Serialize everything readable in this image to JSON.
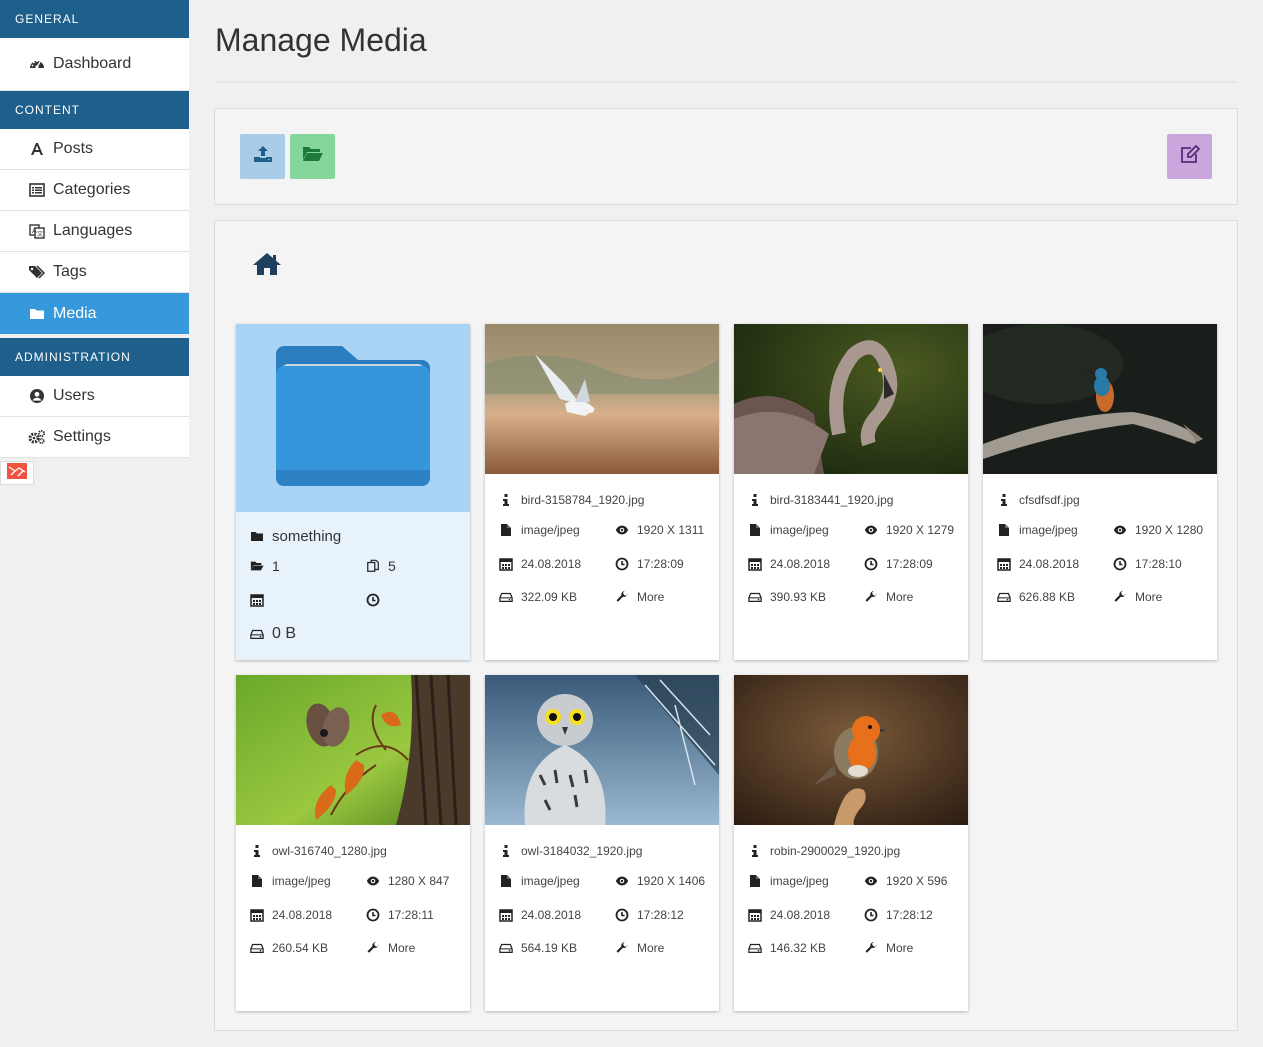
{
  "sidebar": {
    "sections": [
      {
        "label": "GENERAL"
      },
      {
        "label": "CONTENT"
      },
      {
        "label": "ADMINISTRATION"
      }
    ],
    "items": {
      "dashboard": "Dashboard",
      "posts": "Posts",
      "categories": "Categories",
      "languages": "Languages",
      "tags": "Tags",
      "media": "Media",
      "users": "Users",
      "settings": "Settings"
    },
    "active": "media"
  },
  "page": {
    "title": "Manage Media"
  },
  "colors": {
    "sidebar_header": "#1f5f8b",
    "active": "#3599db",
    "upload_button": "#a9cce8",
    "new_folder_button": "#86d69c",
    "edit_button": "#c9a6dc",
    "folder_bg": "#a8d3f5"
  },
  "toolbar": {
    "upload_icon": "upload-icon",
    "new_folder_icon": "folder-open-icon",
    "edit_icon": "edit-icon"
  },
  "breadcrumb": {
    "home_icon": "home-icon"
  },
  "folder": {
    "name": "something",
    "subfolders": "1",
    "files": "5",
    "date": "",
    "time": "",
    "size": "0 B"
  },
  "files": [
    {
      "name": "bird-3158784_1920.jpg",
      "type": "image/jpeg",
      "dimensions": "1920 X 1311",
      "date": "24.08.2018",
      "time": "17:28:09",
      "size": "322.09 KB",
      "more": "More"
    },
    {
      "name": "bird-3183441_1920.jpg",
      "type": "image/jpeg",
      "dimensions": "1920 X 1279",
      "date": "24.08.2018",
      "time": "17:28:09",
      "size": "390.93 KB",
      "more": "More"
    },
    {
      "name": "cfsdfsdf.jpg",
      "type": "image/jpeg",
      "dimensions": "1920 X 1280",
      "date": "24.08.2018",
      "time": "17:28:10",
      "size": "626.88 KB",
      "more": "More"
    },
    {
      "name": "owl-316740_1280.jpg",
      "type": "image/jpeg",
      "dimensions": "1280 X 847",
      "date": "24.08.2018",
      "time": "17:28:11",
      "size": "260.54 KB",
      "more": "More"
    },
    {
      "name": "owl-3184032_1920.jpg",
      "type": "image/jpeg",
      "dimensions": "1920 X 1406",
      "date": "24.08.2018",
      "time": "17:28:12",
      "size": "564.19 KB",
      "more": "More"
    },
    {
      "name": "robin-2900029_1920.jpg",
      "type": "image/jpeg",
      "dimensions": "1920 X 596",
      "date": "24.08.2018",
      "time": "17:28:12",
      "size": "146.32 KB",
      "more": "More"
    }
  ]
}
